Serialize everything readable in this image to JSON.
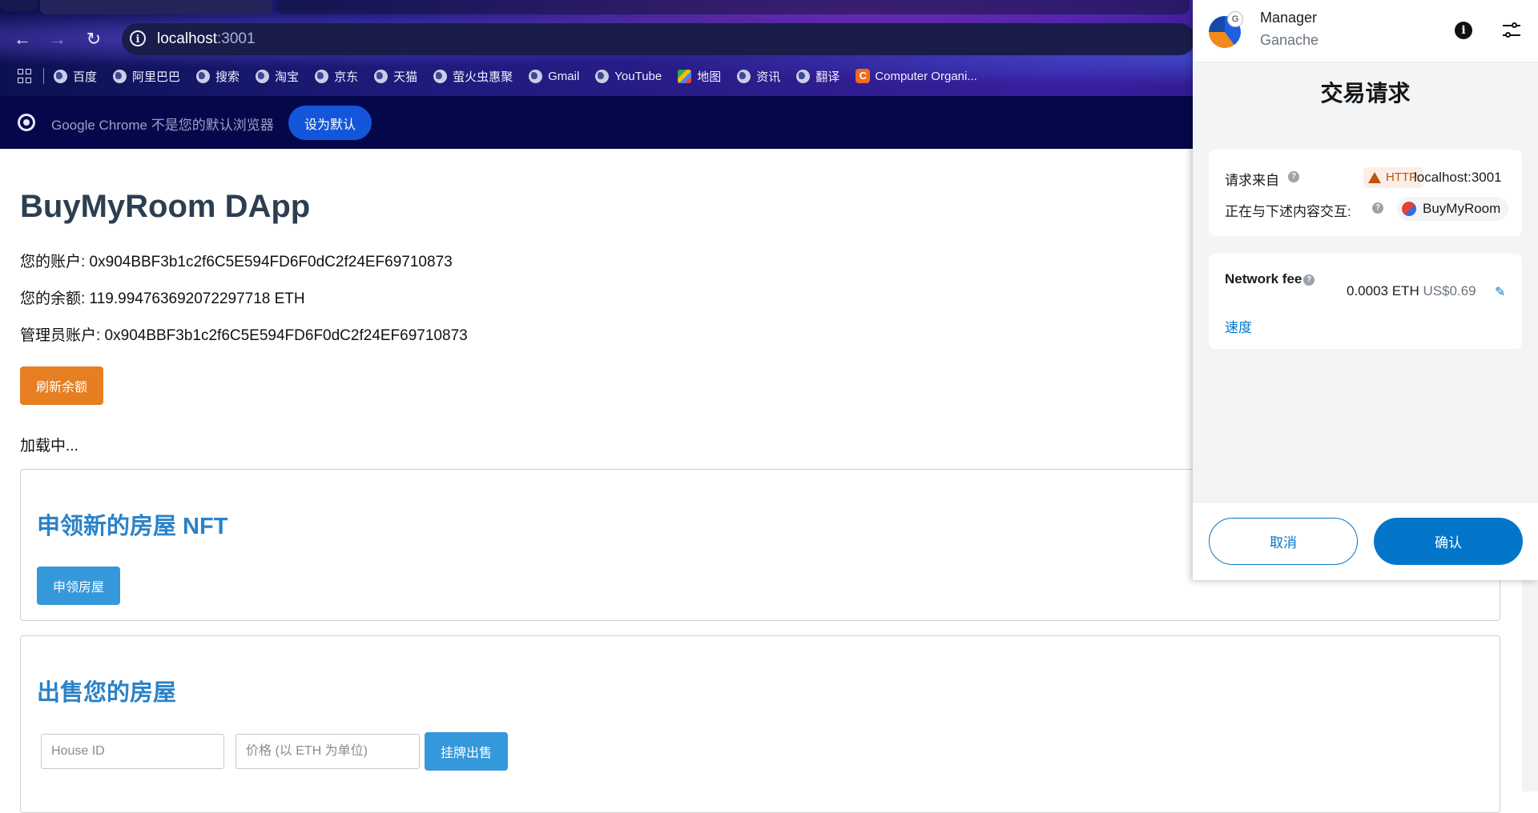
{
  "browser": {
    "url_host": "localhost",
    "url_port": ":3001",
    "bookmarks": [
      "百度",
      "阿里巴巴",
      "搜索",
      "淘宝",
      "京东",
      "天猫",
      "萤火虫惠聚",
      "Gmail",
      "YouTube",
      "地图",
      "资讯",
      "翻译",
      "Computer Organi..."
    ],
    "infobar_text": "Google Chrome 不是您的默认浏览器",
    "infobar_button": "设为默认"
  },
  "page": {
    "title": "BuyMyRoom DApp",
    "account_line": "您的账户: 0x904BBF3b1c2f6C5E594FD6F0dC2f24EF69710873",
    "balance_line": "您的余额: 119.994763692072297718 ETH",
    "admin_line": "管理员账户: 0x904BBF3b1c2f6C5E594FD6F0dC2f24EF69710873",
    "refresh_button": "刷新余额",
    "loading": "加载中...",
    "mint_section": {
      "title": "申领新的房屋 NFT",
      "button": "申领房屋"
    },
    "sell_section": {
      "title": "出售您的房屋",
      "house_id_placeholder": "House ID",
      "price_placeholder": "价格 (以 ETH 为单位)",
      "button": "挂牌出售"
    }
  },
  "metamask": {
    "account_name": "Manager",
    "network": "Ganache",
    "avatar_badge": "G",
    "title": "交易请求",
    "request_from_label": "请求来自",
    "http_badge": "HTTP",
    "origin": "localhost:3001",
    "interacting_label": "正在与下述内容交互:",
    "dapp_name": "BuyMyRoom",
    "fee_label": "Network fee",
    "fee_eth": "0.0003 ETH",
    "fee_usd": "US$0.69",
    "speed_link": "速度",
    "cancel": "取消",
    "confirm": "确认"
  },
  "colors": {
    "accent_orange": "#e67e22",
    "accent_blue": "#3498db",
    "metamask_blue": "#0376c9"
  }
}
